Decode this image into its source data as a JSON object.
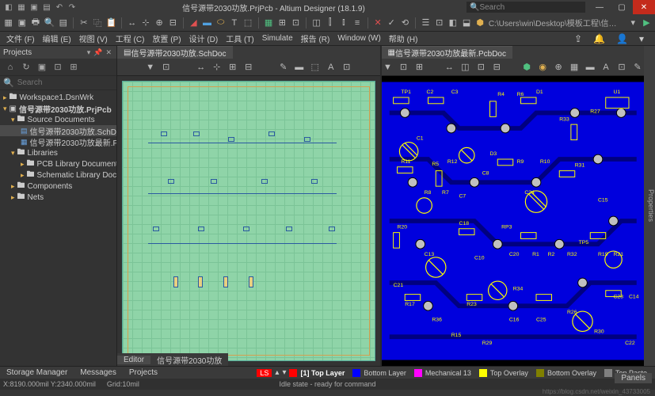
{
  "title": "信号源带2030功放.PrjPcb - Altium Designer (18.1.9)",
  "search_placeholder": "Search",
  "project_path": "C:\\Users\\win\\Desktop\\模板工程\\信号源带20...",
  "menu": [
    "文件 (F)",
    "编辑 (E)",
    "视图 (V)",
    "工程 (C)",
    "放置 (P)",
    "设计 (D)",
    "工具 (T)",
    "Simulate",
    "报告 (R)",
    "Window (W)",
    "帮助 (H)"
  ],
  "sidebar": {
    "title": "Projects",
    "search_placeholder": "Search",
    "tree": {
      "workspace": "Workspace1.DsnWrk",
      "project": "信号源带2030功放.PrjPcb",
      "source_docs": "Source Documents",
      "sch_doc": "信号源带2030功放.SchDoc",
      "pcb_doc": "信号源带2030功放最新.PcbDoc",
      "libraries": "Libraries",
      "pcb_lib": "PCB Library Documents",
      "sch_lib": "Schematic Library Documents",
      "components": "Components",
      "nets": "Nets"
    }
  },
  "editor_left": {
    "tab": "信号源带2030功放.SchDoc",
    "bottom_tabs": [
      "Editor",
      "信号源带2030功放"
    ]
  },
  "editor_right": {
    "tab": "信号源带2030功放最新.PcbDoc",
    "designators": [
      "TP1",
      "C2",
      "C3",
      "R33",
      "R4",
      "R6",
      "D1",
      "R27",
      "U1",
      "C1",
      "R11",
      "R5",
      "D3",
      "R12",
      "C8",
      "R9",
      "R10",
      "C7",
      "R31",
      "C24",
      "R8",
      "R7",
      "C15",
      "R20",
      "C18",
      "RP3",
      "TP5",
      "C13",
      "C10",
      "C20",
      "R1",
      "R2",
      "R32",
      "C21",
      "R19",
      "R21",
      "R17",
      "R23",
      "R34",
      "C23",
      "C14",
      "R36",
      "C16",
      "R26",
      "R30",
      "C22",
      "C25",
      "R29",
      "R15"
    ]
  },
  "right_panel": "Properties",
  "status": {
    "left_tabs": [
      "Storage Manager",
      "Messages",
      "Projects"
    ],
    "layers": [
      {
        "name": "[1] Top Layer",
        "color": "#ff0000",
        "active": true
      },
      {
        "name": "Bottom Layer",
        "color": "#0000ff"
      },
      {
        "name": "Mechanical 13",
        "color": "#ff00ff"
      },
      {
        "name": "Top Overlay",
        "color": "#ffff00"
      },
      {
        "name": "Bottom Overlay",
        "color": "#808000"
      },
      {
        "name": "Top Paste",
        "color": "#808080"
      }
    ],
    "ls": "LS",
    "panels": "Panels"
  },
  "coords": {
    "xy": "X:8190.000mil Y:2340.000mil",
    "grid": "Grid:10mil",
    "state": "Idle state - ready for command",
    "watermark": "https://blog.csdn.net/weixin_43733005"
  }
}
